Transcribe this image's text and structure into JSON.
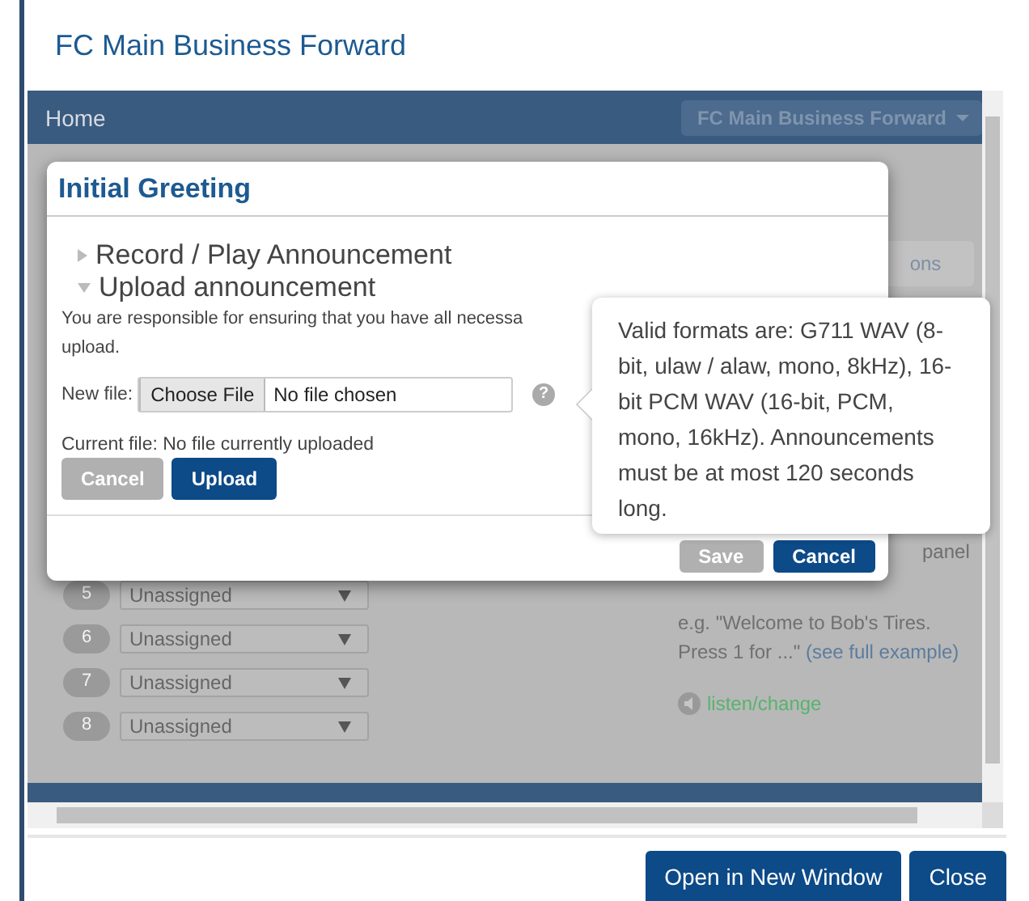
{
  "window": {
    "title": "FC Main Business Forward"
  },
  "page": {
    "nav": {
      "home": "Home",
      "account_menu": "FC Main Business Forward"
    },
    "options_button": "ons",
    "rows": [
      {
        "number": "5",
        "value": "Unassigned"
      },
      {
        "number": "6",
        "value": "Unassigned"
      },
      {
        "number": "7",
        "value": "Unassigned"
      },
      {
        "number": "8",
        "value": "Unassigned"
      }
    ],
    "side_note": "panel",
    "example": {
      "text": "e.g. \"Welcome to Bob's Tires. Press 1 for ...\"",
      "link": "(see full example)"
    },
    "listen_link": "listen/change"
  },
  "modal": {
    "title": "Initial Greeting",
    "sections": [
      {
        "label": "Record / Play Announcement",
        "expanded": false
      },
      {
        "label": "Upload announcement",
        "expanded": true
      }
    ],
    "notice_lines": [
      "You are responsible for ensuring that you have all necessa",
      "upload."
    ],
    "file_label": "New file:",
    "choose_button": "Choose File",
    "file_status": "No file chosen",
    "help_icon": "?",
    "current_file": "Current file: No file currently uploaded",
    "upload_buttons": [
      {
        "label": "Cancel",
        "disabled": true,
        "primary": false
      },
      {
        "label": "Upload",
        "disabled": false,
        "primary": true
      }
    ],
    "footer_buttons": [
      {
        "label": "Save",
        "disabled": true,
        "primary": false
      },
      {
        "label": "Cancel",
        "disabled": false,
        "primary": true
      }
    ]
  },
  "popover": {
    "text": "Valid formats are: G711 WAV (8-bit, ulaw / alaw, mono, 8kHz), 16-bit PCM WAV (16-bit, PCM, mono, 16kHz). Announcements must be at most 120 seconds long."
  },
  "footer_buttons": [
    "Open in New Window",
    "Close"
  ]
}
